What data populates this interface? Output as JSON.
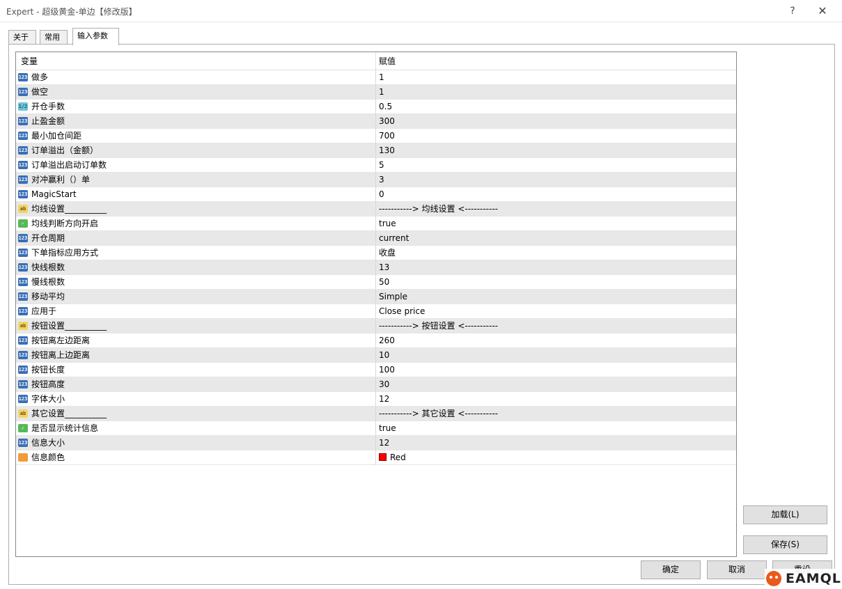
{
  "window": {
    "title": "Expert - 超级黄金-单边【修改版】",
    "help_label": "?",
    "close_label": "✕"
  },
  "tabs": [
    {
      "label": "关于"
    },
    {
      "label": "常用"
    },
    {
      "label": "输入参数"
    }
  ],
  "grid": {
    "header": {
      "variable": "变量",
      "value": "赋值"
    },
    "rows": [
      {
        "icon": "int-icon",
        "badge": "123",
        "name": "做多",
        "value": "1"
      },
      {
        "icon": "int-icon",
        "badge": "123",
        "name": "做空",
        "value": "1"
      },
      {
        "icon": "double-icon",
        "badge": "1/2",
        "name": "开仓手数",
        "value": "0.5"
      },
      {
        "icon": "int-icon",
        "badge": "123",
        "name": "止盈金额",
        "value": "300"
      },
      {
        "icon": "int-icon",
        "badge": "123",
        "name": "最小加仓间距",
        "value": "700"
      },
      {
        "icon": "int-icon",
        "badge": "123",
        "name": "订单溢出（金额）",
        "value": "130"
      },
      {
        "icon": "int-icon",
        "badge": "123",
        "name": "订单溢出启动订单数",
        "value": "5"
      },
      {
        "icon": "int-icon",
        "badge": "123",
        "name": "对冲赢利（）单",
        "value": "3"
      },
      {
        "icon": "int-icon",
        "badge": "123",
        "name": "MagicStart",
        "value": "0"
      },
      {
        "icon": "string-icon",
        "badge": "ab",
        "name": "均线设置__________",
        "value": "-----------> 均线设置 <-----------"
      },
      {
        "icon": "bool-icon",
        "badge": "✓",
        "name": "均线判断方向开启",
        "value": "true"
      },
      {
        "icon": "enum-icon",
        "badge": "123",
        "name": "开仓周期",
        "value": "current"
      },
      {
        "icon": "enum-icon",
        "badge": "123",
        "name": "下单指标应用方式",
        "value": "收盘"
      },
      {
        "icon": "int-icon",
        "badge": "123",
        "name": "快线根数",
        "value": "13"
      },
      {
        "icon": "int-icon",
        "badge": "123",
        "name": "慢线根数",
        "value": "50"
      },
      {
        "icon": "enum-icon",
        "badge": "123",
        "name": "移动平均",
        "value": "Simple"
      },
      {
        "icon": "enum-icon",
        "badge": "123",
        "name": "应用于",
        "value": "Close price"
      },
      {
        "icon": "string-icon",
        "badge": "ab",
        "name": "按钮设置__________",
        "value": "-----------> 按钮设置 <-----------"
      },
      {
        "icon": "int-icon",
        "badge": "123",
        "name": "按钮离左边距离",
        "value": "260"
      },
      {
        "icon": "int-icon",
        "badge": "123",
        "name": "按钮离上边距离",
        "value": "10"
      },
      {
        "icon": "int-icon",
        "badge": "123",
        "name": "按钮长度",
        "value": "100"
      },
      {
        "icon": "int-icon",
        "badge": "123",
        "name": "按钮高度",
        "value": "30"
      },
      {
        "icon": "int-icon",
        "badge": "123",
        "name": "字体大小",
        "value": "12"
      },
      {
        "icon": "string-icon",
        "badge": "ab",
        "name": "其它设置__________",
        "value": "-----------> 其它设置 <-----------"
      },
      {
        "icon": "bool-icon",
        "badge": "✓",
        "name": "是否显示统计信息",
        "value": "true"
      },
      {
        "icon": "int-icon",
        "badge": "123",
        "name": "信息大小",
        "value": "12"
      },
      {
        "icon": "color-icon",
        "badge": "",
        "name": "信息颜色",
        "value": "Red",
        "swatch": "#ff0000"
      }
    ]
  },
  "buttons": {
    "load": "加载(L)",
    "save": "保存(S)",
    "ok": "确定",
    "cancel": "取消",
    "reset": "重设"
  },
  "watermark": {
    "text": "EAMQL"
  }
}
